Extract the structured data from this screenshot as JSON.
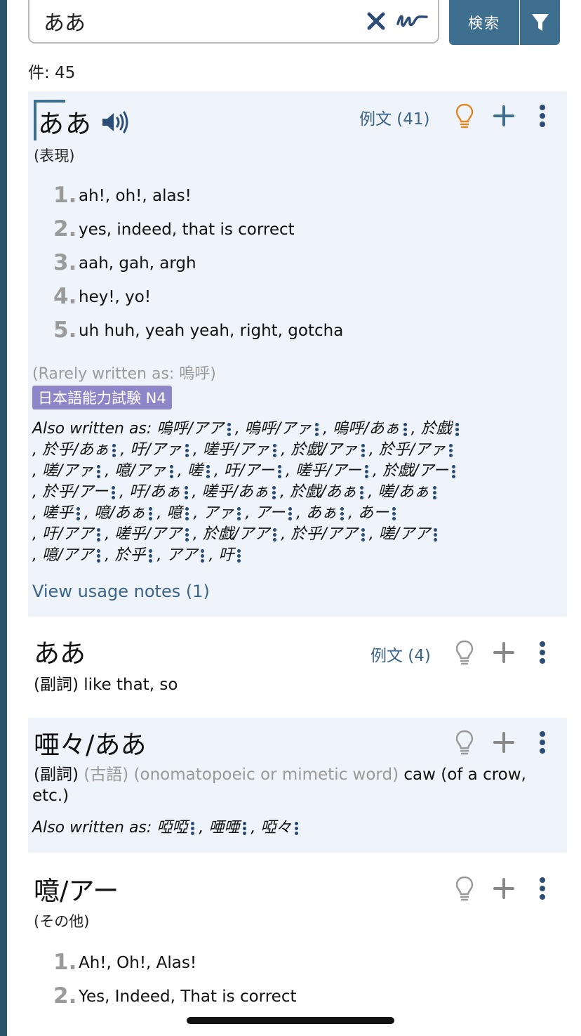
{
  "search": {
    "query": "ああ",
    "button_label": "検索"
  },
  "count_label": "件: 45",
  "entries": [
    {
      "headword_first": "あ",
      "headword_rest": "あ",
      "examples_label": "例文 (41)",
      "pos": "(表現)",
      "senses": [
        {
          "num": "1.",
          "text": "ah!, oh!, alas!"
        },
        {
          "num": "2.",
          "text": "yes, indeed, that is correct"
        },
        {
          "num": "3.",
          "text": "aah, gah, argh"
        },
        {
          "num": "4.",
          "text": "hey!, yo!"
        },
        {
          "num": "5.",
          "text": "uh huh, yeah yeah, right, gotcha"
        }
      ],
      "rarely_written": "(Rarely written as: 嗚呼)",
      "jlpt": "日本語能力試験 N4",
      "also_label": "Also written as",
      "also_lines": [
        [
          "嗚呼/アア",
          "嗚呼/アァ",
          "嗚呼/あぁ",
          "於戯"
        ],
        [
          "於乎/あぁ",
          "吁/アァ",
          "嗟乎/アァ",
          "於戯/アァ",
          "於乎/アァ"
        ],
        [
          "嗟/アァ",
          "噫/アァ",
          "嗟",
          "吁/アー",
          "嗟乎/アー",
          "於戯/アー"
        ],
        [
          "於乎/アー",
          "吁/あぁ",
          "嗟乎/あぁ",
          "於戯/あぁ",
          "嗟/あぁ"
        ],
        [
          "嗟乎",
          "噫/あぁ",
          "噫",
          "アァ",
          "アー",
          "あぁ",
          "あー"
        ],
        [
          "吁/アア",
          "嗟乎/アア",
          "於戯/アア",
          "於乎/アア",
          "嗟/アア"
        ],
        [
          "噫/アア",
          "於乎",
          "アア",
          "吁"
        ]
      ],
      "usage_notes": "View usage notes (1)"
    },
    {
      "headword": "ああ",
      "examples_label": "例文 (4)",
      "definition_pos": "(副詞)",
      "definition": "like that, so"
    },
    {
      "headword": "唖々/ああ",
      "definition_pos": "(副詞)",
      "definition_tag1": "(古語)",
      "definition_tag2": "(onomatopoeic or mimetic word)",
      "definition": "caw (of a crow,",
      "definition_cont": "etc.)",
      "also_label": "Also written as",
      "also_lines": [
        [
          "啞啞",
          "唖唖",
          "啞々"
        ]
      ]
    },
    {
      "headword": "噫/アー",
      "pos": "(その他)",
      "senses": [
        {
          "num": "1.",
          "text": "Ah!, Oh!, Alas!"
        },
        {
          "num": "2.",
          "text": "Yes, Indeed, That is correct"
        }
      ]
    }
  ],
  "icons": {
    "clear": "x-icon",
    "handwriting": "handwriting-icon",
    "filter": "filter-icon",
    "speaker": "speaker-icon",
    "lightbulb": "lightbulb-icon",
    "add": "plus-icon",
    "more": "more-vertical-icon"
  },
  "colors": {
    "accent": "#3f6f8e",
    "link": "#3c6489",
    "lightbulb_active": "#e08a2c",
    "lightbulb_inactive": "#9a9a9a",
    "jlpt_badge": "#8f86c9",
    "shaded_bg": "#eef4fa"
  }
}
